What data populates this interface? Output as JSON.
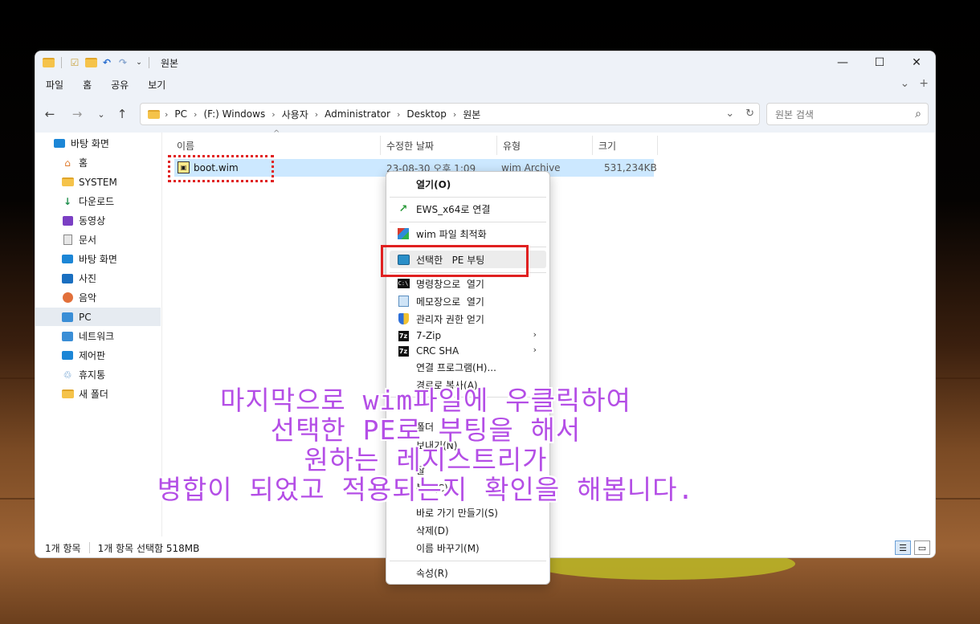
{
  "window": {
    "title": "원본",
    "controls": {
      "minimize": "—",
      "maximize": "☐",
      "close": "✕"
    }
  },
  "menu": {
    "items": [
      "파일",
      "홈",
      "공유",
      "보기"
    ],
    "expand_icon": "chevron-down-icon",
    "add_icon": "plus-icon"
  },
  "address": {
    "crumbs": [
      "PC",
      "(F:) Windows",
      "사용자",
      "Administrator",
      "Desktop",
      "원본"
    ],
    "search_placeholder": "원본 검색"
  },
  "sidebar": {
    "items": [
      {
        "label": "바탕 화면",
        "icon": "desktop-icon"
      },
      {
        "label": "홈",
        "icon": "home-icon"
      },
      {
        "label": "SYSTEM",
        "icon": "folder-icon"
      },
      {
        "label": "다운로드",
        "icon": "download-icon"
      },
      {
        "label": "동영상",
        "icon": "video-icon"
      },
      {
        "label": "문서",
        "icon": "document-icon"
      },
      {
        "label": "바탕 화면",
        "icon": "desktop-icon"
      },
      {
        "label": "사진",
        "icon": "picture-icon"
      },
      {
        "label": "음악",
        "icon": "music-icon"
      },
      {
        "label": "PC",
        "icon": "pc-icon"
      },
      {
        "label": "네트워크",
        "icon": "network-icon"
      },
      {
        "label": "제어판",
        "icon": "control-panel-icon"
      },
      {
        "label": "휴지통",
        "icon": "recycle-bin-icon"
      },
      {
        "label": "새 폴더",
        "icon": "folder-icon"
      }
    ],
    "selected": "PC"
  },
  "columns": {
    "name": "이름",
    "date": "수정한 날짜",
    "type": "유형",
    "size": "크기"
  },
  "file": {
    "name": "boot.wim",
    "date": "23-08-30 오후 1:09",
    "type": "wim Archive",
    "size": "531,234KB"
  },
  "status": {
    "count": "1개 항목",
    "selection": "1개 항목 선택함 518MB"
  },
  "context_menu": {
    "open": "열기(O)",
    "ews": "EWS_x64로 연결",
    "optimize": "wim 파일 최적화",
    "pe_boot": "선택한   PE 부팅",
    "cmd": "명령창으로  열기",
    "notepad": "메모장으로  열기",
    "admin": "관리자 권한 얻기",
    "zip": "7-Zip",
    "crc": "CRC SHA",
    "open_with": "연결 프로그램(H)...",
    "copy_path": "경로로 복사(A)",
    "folder_partial": "폴더",
    "send_to": "보내기(N)",
    "cut_partial": "잘",
    "copy_partial": "복사(C)",
    "shortcut": "바로 가기 만들기(S)",
    "delete": "삭제(D)",
    "rename": "이름 바꾸기(M)",
    "properties": "속성(R)"
  },
  "caption": {
    "line1": "마지막으로 wim파일에 우클릭하여",
    "line2": "선택한 PE로 부팅을 해서",
    "line3": "원하는 레지스트리가",
    "line4": "병합이 되었고 적용되는지 확인을 해봅니다."
  }
}
